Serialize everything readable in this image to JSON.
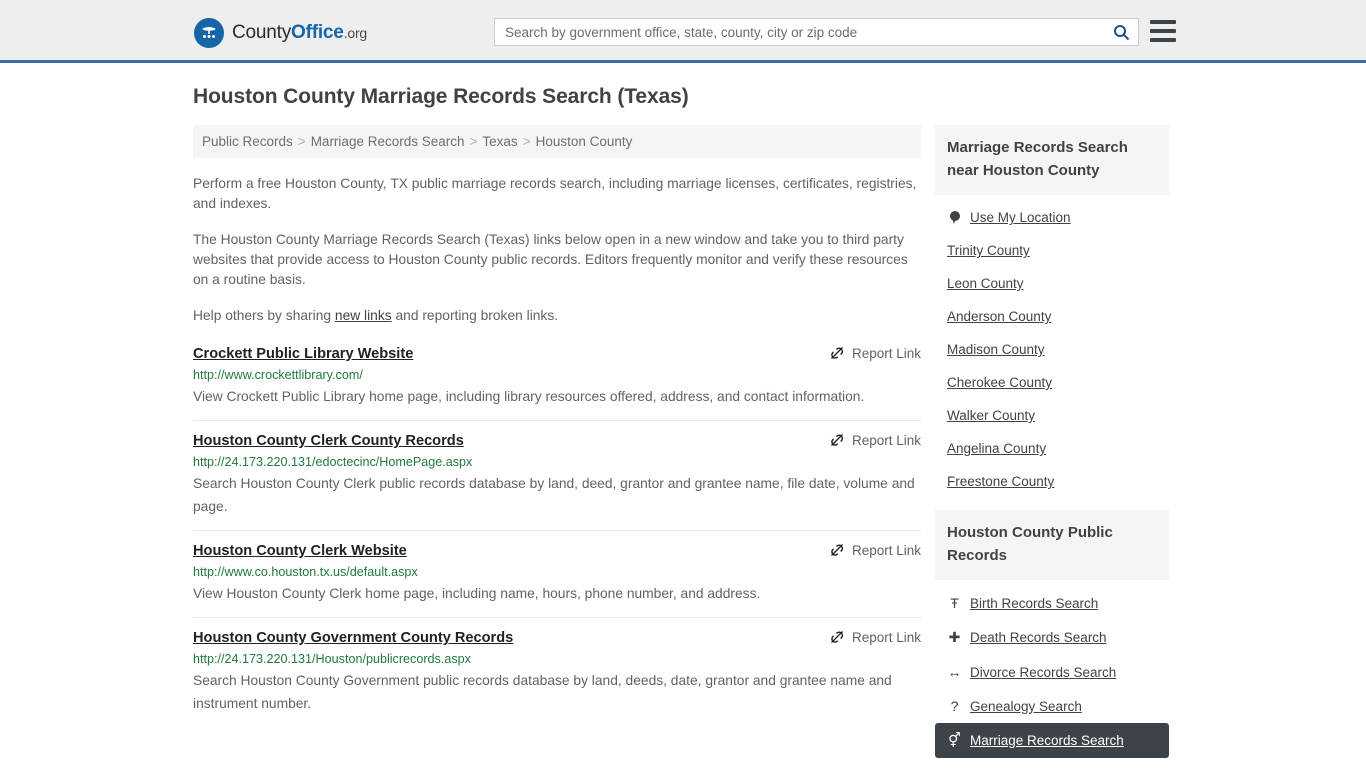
{
  "header": {
    "brand": {
      "part1": "County",
      "part2": "Office",
      "part3": ".org",
      "logo_icon": "eagle-shield-icon"
    },
    "search": {
      "placeholder": "Search by government office, state, county, city or zip code",
      "value": "",
      "icon": "search-icon"
    },
    "menu_icon": "hamburger-menu-icon"
  },
  "page": {
    "title": "Houston County Marriage Records Search (Texas)"
  },
  "breadcrumb": {
    "items": [
      "Public Records",
      "Marriage Records Search",
      "Texas",
      "Houston County"
    ],
    "separator": ">"
  },
  "intro": {
    "p1": "Perform a free Houston County, TX public marriage records search, including marriage licenses, certificates, registries, and indexes.",
    "p2": "The Houston County Marriage Records Search (Texas) links below open in a new window and take you to third party websites that provide access to Houston County public records. Editors frequently monitor and verify these resources on a routine basis.",
    "p3_before": "Help others by sharing ",
    "p3_link": "new links",
    "p3_after": " and reporting broken links."
  },
  "results": {
    "report_label": "Report Link",
    "report_icon": "unlink-icon",
    "items": [
      {
        "title": "Crockett Public Library Website",
        "url": "http://www.crockettlibrary.com/",
        "description": "View Crockett Public Library home page, including library resources offered, address, and contact information."
      },
      {
        "title": "Houston County Clerk County Records",
        "url": "http://24.173.220.131/edoctecinc/HomePage.aspx",
        "description": "Search Houston County Clerk public records database by land, deed, grantor and grantee name, file date, volume and page."
      },
      {
        "title": "Houston County Clerk Website",
        "url": "http://www.co.houston.tx.us/default.aspx",
        "description": "View Houston County Clerk home page, including name, hours, phone number, and address."
      },
      {
        "title": "Houston County Government County Records",
        "url": "http://24.173.220.131/Houston/publicrecords.aspx",
        "description": "Search Houston County Government public records database by land, deeds, date, grantor and grantee name and instrument number."
      }
    ]
  },
  "sidebar": {
    "nearby": {
      "heading": "Marriage Records Search near Houston County",
      "items": [
        {
          "label": "Use My Location",
          "icon": "map-pin-icon"
        },
        {
          "label": "Trinity County",
          "icon": ""
        },
        {
          "label": "Leon County",
          "icon": ""
        },
        {
          "label": "Anderson County",
          "icon": ""
        },
        {
          "label": "Madison County",
          "icon": ""
        },
        {
          "label": "Cherokee County",
          "icon": ""
        },
        {
          "label": "Walker County",
          "icon": ""
        },
        {
          "label": "Angelina County",
          "icon": ""
        },
        {
          "label": "Freestone County",
          "icon": ""
        }
      ]
    },
    "public_records": {
      "heading": "Houston County Public Records",
      "items": [
        {
          "label": "Birth Records Search",
          "icon": "baby-icon",
          "glyph": "Ŧ",
          "active": false
        },
        {
          "label": "Death Records Search",
          "icon": "cross-icon",
          "glyph": "✚",
          "active": false
        },
        {
          "label": "Divorce Records Search",
          "icon": "left-right-arrow-icon",
          "glyph": "↔",
          "active": false
        },
        {
          "label": "Genealogy Search",
          "icon": "question-mark-icon",
          "glyph": "?",
          "active": false
        },
        {
          "label": "Marriage Records Search",
          "icon": "gender-symbols-icon",
          "glyph": "⚥",
          "active": true
        }
      ]
    }
  },
  "colors": {
    "header_bg": "#eeeeee",
    "header_border": "#3a6ea5",
    "brand_blue": "#1565a8",
    "url_green": "#1f7a3d",
    "text_gray": "#5f6368",
    "dark": "#3d4348",
    "panel_bg": "#f5f5f5"
  }
}
